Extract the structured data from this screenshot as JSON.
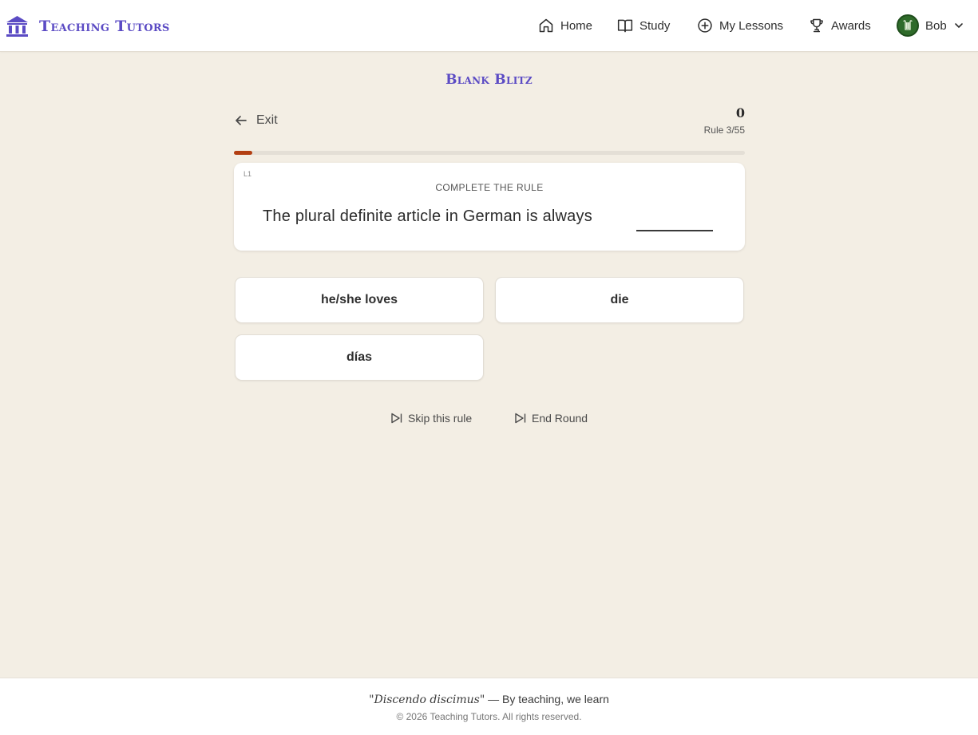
{
  "header": {
    "brand": "Teaching Tutors",
    "nav": [
      {
        "label": "Home",
        "icon": "home-icon"
      },
      {
        "label": "Study",
        "icon": "book-icon"
      },
      {
        "label": "My Lessons",
        "icon": "plus-circle-icon"
      },
      {
        "label": "Awards",
        "icon": "trophy-icon"
      }
    ],
    "user": {
      "name": "Bob",
      "icon": "avatar-lyre-icon"
    }
  },
  "game": {
    "title": "Blank Blitz",
    "exit_label": "Exit",
    "score": "0",
    "rule_progress": "Rule 3/55",
    "progress_fraction": 0.036,
    "level": "L1",
    "prompt_label": "COMPLETE THE RULE",
    "prompt_text": "The plural definite article in German is always",
    "options": [
      "he/she loves",
      "die",
      "días"
    ],
    "skip_label": "Skip this rule",
    "end_label": "End Round"
  },
  "footer": {
    "motto_latin": "\"Discendo discimus\"",
    "motto_rest": " — By teaching, we learn",
    "copyright": "© 2026 Teaching Tutors. All rights reserved."
  },
  "colors": {
    "accent": "#5b4bc4",
    "progress": "#b33f12",
    "background": "#f3eee4",
    "avatar": "#2f6b2a"
  }
}
